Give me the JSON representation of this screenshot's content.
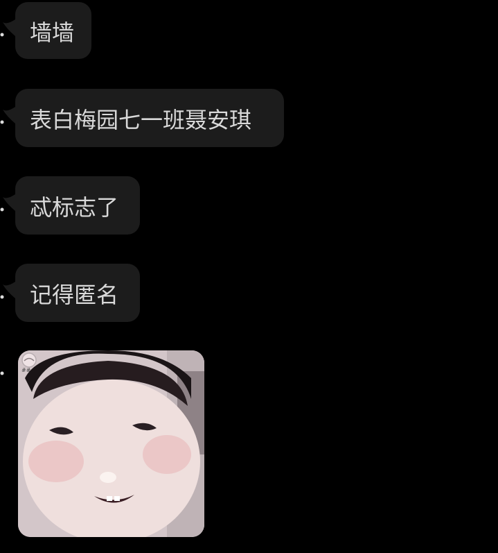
{
  "messages": [
    {
      "text": "墙墙"
    },
    {
      "text": "表白梅园七一班聂安琪"
    },
    {
      "text": "忒标志了"
    },
    {
      "text": "记得匿名"
    }
  ],
  "sticker": {
    "icon": "baby-face-sticker",
    "badge_icon": "sticker-watermark-icon"
  },
  "colors": {
    "background": "#000000",
    "bubble": "#1c1c1c",
    "text": "#d9d9d9"
  }
}
